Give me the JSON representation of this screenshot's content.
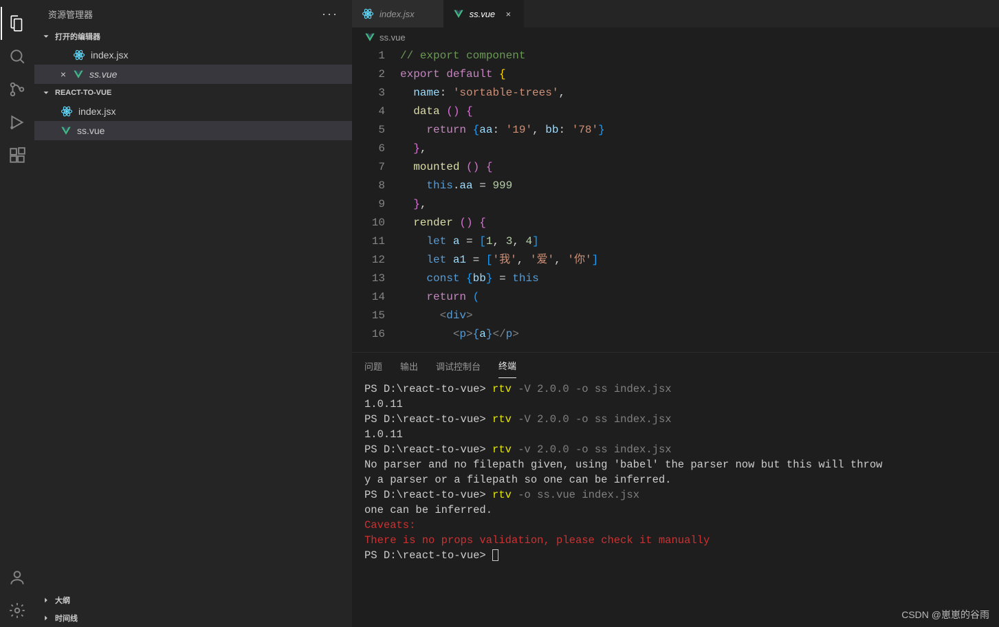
{
  "sidebar": {
    "title": "资源管理器",
    "sections": {
      "open_editors": "打开的编辑器",
      "project": "REACT-TO-VUE",
      "outline": "大纲",
      "timeline": "时间线"
    },
    "open_editors_items": [
      {
        "name": "index.jsx",
        "type": "react"
      },
      {
        "name": "ss.vue",
        "type": "vue",
        "active": true
      }
    ],
    "files": [
      {
        "name": "index.jsx",
        "type": "react"
      },
      {
        "name": "ss.vue",
        "type": "vue",
        "active": true
      }
    ]
  },
  "tabs": [
    {
      "name": "index.jsx",
      "type": "react"
    },
    {
      "name": "ss.vue",
      "type": "vue",
      "active": true,
      "closable": true
    }
  ],
  "breadcrumb": {
    "icon": "vue",
    "name": "ss.vue"
  },
  "code_lines": [
    {
      "n": 1,
      "html": "<span class='tok-comment'>// export component</span>"
    },
    {
      "n": 2,
      "html": "<span class='tok-keyword'>export</span> <span class='tok-keyword'>default</span> <span class='tok-brace'>{</span>"
    },
    {
      "n": 3,
      "html": "  <span class='tok-ident'>name</span><span class='tok-punct'>:</span> <span class='tok-string'>'sortable-trees'</span><span class='tok-punct'>,</span>"
    },
    {
      "n": 4,
      "html": "  <span class='tok-func'>data</span> <span class='tok-brace2'>()</span> <span class='tok-brace2'>{</span>"
    },
    {
      "n": 5,
      "html": "    <span class='tok-keyword'>return</span> <span class='tok-brace3'>{</span><span class='tok-ident'>aa</span><span class='tok-punct'>:</span> <span class='tok-string'>'19'</span><span class='tok-punct'>,</span> <span class='tok-ident'>bb</span><span class='tok-punct'>:</span> <span class='tok-string'>'78'</span><span class='tok-brace3'>}</span>"
    },
    {
      "n": 6,
      "html": "  <span class='tok-brace2'>}</span><span class='tok-punct'>,</span>"
    },
    {
      "n": 7,
      "html": "  <span class='tok-func'>mounted</span> <span class='tok-brace2'>()</span> <span class='tok-brace2'>{</span>"
    },
    {
      "n": 8,
      "html": "    <span class='tok-keyword2'>this</span><span class='tok-punct'>.</span><span class='tok-ident'>aa</span> <span class='tok-punct'>=</span> <span class='tok-number'>999</span>"
    },
    {
      "n": 9,
      "html": "  <span class='tok-brace2'>}</span><span class='tok-punct'>,</span>"
    },
    {
      "n": 10,
      "html": "  <span class='tok-func'>render</span> <span class='tok-brace2'>()</span> <span class='tok-brace2'>{</span>"
    },
    {
      "n": 11,
      "html": "    <span class='tok-keyword2'>let</span> <span class='tok-ident'>a</span> <span class='tok-punct'>=</span> <span class='tok-brace3'>[</span><span class='tok-number'>1</span><span class='tok-punct'>,</span> <span class='tok-number'>3</span><span class='tok-punct'>,</span> <span class='tok-number'>4</span><span class='tok-brace3'>]</span>"
    },
    {
      "n": 12,
      "html": "    <span class='tok-keyword2'>let</span> <span class='tok-ident'>a1</span> <span class='tok-punct'>=</span> <span class='tok-brace3'>[</span><span class='tok-string'>'我'</span><span class='tok-punct'>,</span> <span class='tok-string'>'爱'</span><span class='tok-punct'>,</span> <span class='tok-string'>'你'</span><span class='tok-brace3'>]</span>"
    },
    {
      "n": 13,
      "html": "    <span class='tok-keyword2'>const</span> <span class='tok-brace3'>{</span><span class='tok-ident'>bb</span><span class='tok-brace3'>}</span> <span class='tok-punct'>=</span> <span class='tok-keyword2'>this</span>"
    },
    {
      "n": 14,
      "html": "    <span class='tok-keyword'>return</span> <span class='tok-brace3'>(</span>"
    },
    {
      "n": 15,
      "html": "      <span class='tok-tagp'>&lt;</span><span class='tok-tag'>div</span><span class='tok-tagp'>&gt;</span>"
    },
    {
      "n": 16,
      "html": "        <span class='tok-tagp'>&lt;</span><span class='tok-tag'>p</span><span class='tok-tagp'>&gt;</span><span class='tok-keyword2'>{</span><span class='tok-ident'>a</span><span class='tok-keyword2'>}</span><span class='tok-tagp'>&lt;/</span><span class='tok-tag'>p</span><span class='tok-tagp'>&gt;</span>"
    }
  ],
  "panel": {
    "tabs": [
      "问题",
      "输出",
      "调试控制台",
      "终端"
    ],
    "active_tab": 3
  },
  "terminal_lines": [
    {
      "html": "PS D:\\react-to-vue> <span class='term-yellow'>rtv</span> <span class='term-gray'>-V</span> <span class='term-gray'>2.0.0</span> <span class='term-gray'>-o</span> <span class='term-gray'>ss</span> <span class='term-gray'>index.jsx</span>"
    },
    {
      "html": "1.0.11"
    },
    {
      "html": "PS D:\\react-to-vue> <span class='term-yellow'>rtv</span> <span class='term-gray'>-V</span> <span class='term-gray'>2.0.0</span> <span class='term-gray'>-o</span> <span class='term-gray'>ss</span> <span class='term-gray'>index.jsx</span>"
    },
    {
      "html": "1.0.11"
    },
    {
      "html": "PS D:\\react-to-vue> <span class='term-yellow'>rtv</span> <span class='term-gray'>-v</span>  <span class='term-gray'>2.0.0</span> <span class='term-gray'>-o</span> <span class='term-gray'>ss</span> <span class='term-gray'>index.jsx</span>"
    },
    {
      "html": "No parser and no filepath given, using 'babel' the parser now but this will throw"
    },
    {
      "html": "y a parser or a filepath so one can be inferred."
    },
    {
      "html": "PS D:\\react-to-vue> <span class='term-yellow'>rtv</span>  <span class='term-gray'>-o</span> <span class='term-gray'>ss.vue</span>  <span class='term-gray'>index.jsx</span>"
    },
    {
      "html": "one can be inferred."
    },
    {
      "html": "<span class='term-red'>Caveats:</span>"
    },
    {
      "html": "<span class='term-red'>There is no props validation, please check it manually</span>"
    },
    {
      "html": "PS D:\\react-to-vue> <span class='cursor-block'></span>"
    }
  ],
  "watermark": "CSDN @崽崽的谷雨"
}
